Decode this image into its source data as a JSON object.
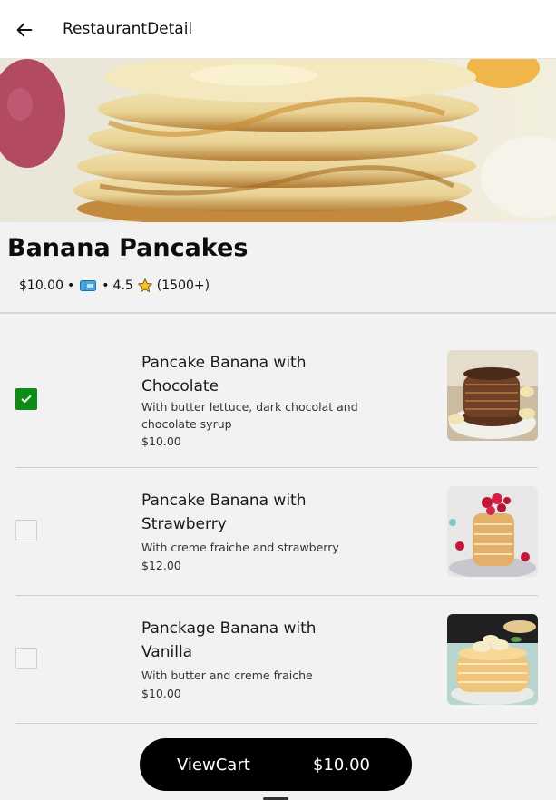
{
  "appbar": {
    "title": "RestaurantDetail",
    "back_icon": "arrow-left-icon"
  },
  "restaurant": {
    "name": "Banana Pancakes",
    "price": "$10.00",
    "separator": "•",
    "rating": "4.5",
    "review_count": "(1500+)",
    "icons": [
      "ticket-icon",
      "star-icon"
    ]
  },
  "menu": {
    "items": [
      {
        "title": "Pancake Banana with Chocolate",
        "description": "With butter lettuce, dark chocolat and chocolate syrup",
        "price": "$10.00",
        "checked": true
      },
      {
        "title": "Pancake Banana with Strawberry",
        "description": "With creme fraiche and strawberry",
        "price": "$12.00",
        "checked": false
      },
      {
        "title": "Panckage Banana with Vanilla",
        "description": "With butter and creme fraiche",
        "price": "$10.00",
        "checked": false
      }
    ]
  },
  "cart": {
    "label": "ViewCart",
    "total": "$10.00"
  },
  "colors": {
    "accent": "#0e8a16",
    "cart_bg": "#000000",
    "page_bg": "#f2f2f2"
  }
}
